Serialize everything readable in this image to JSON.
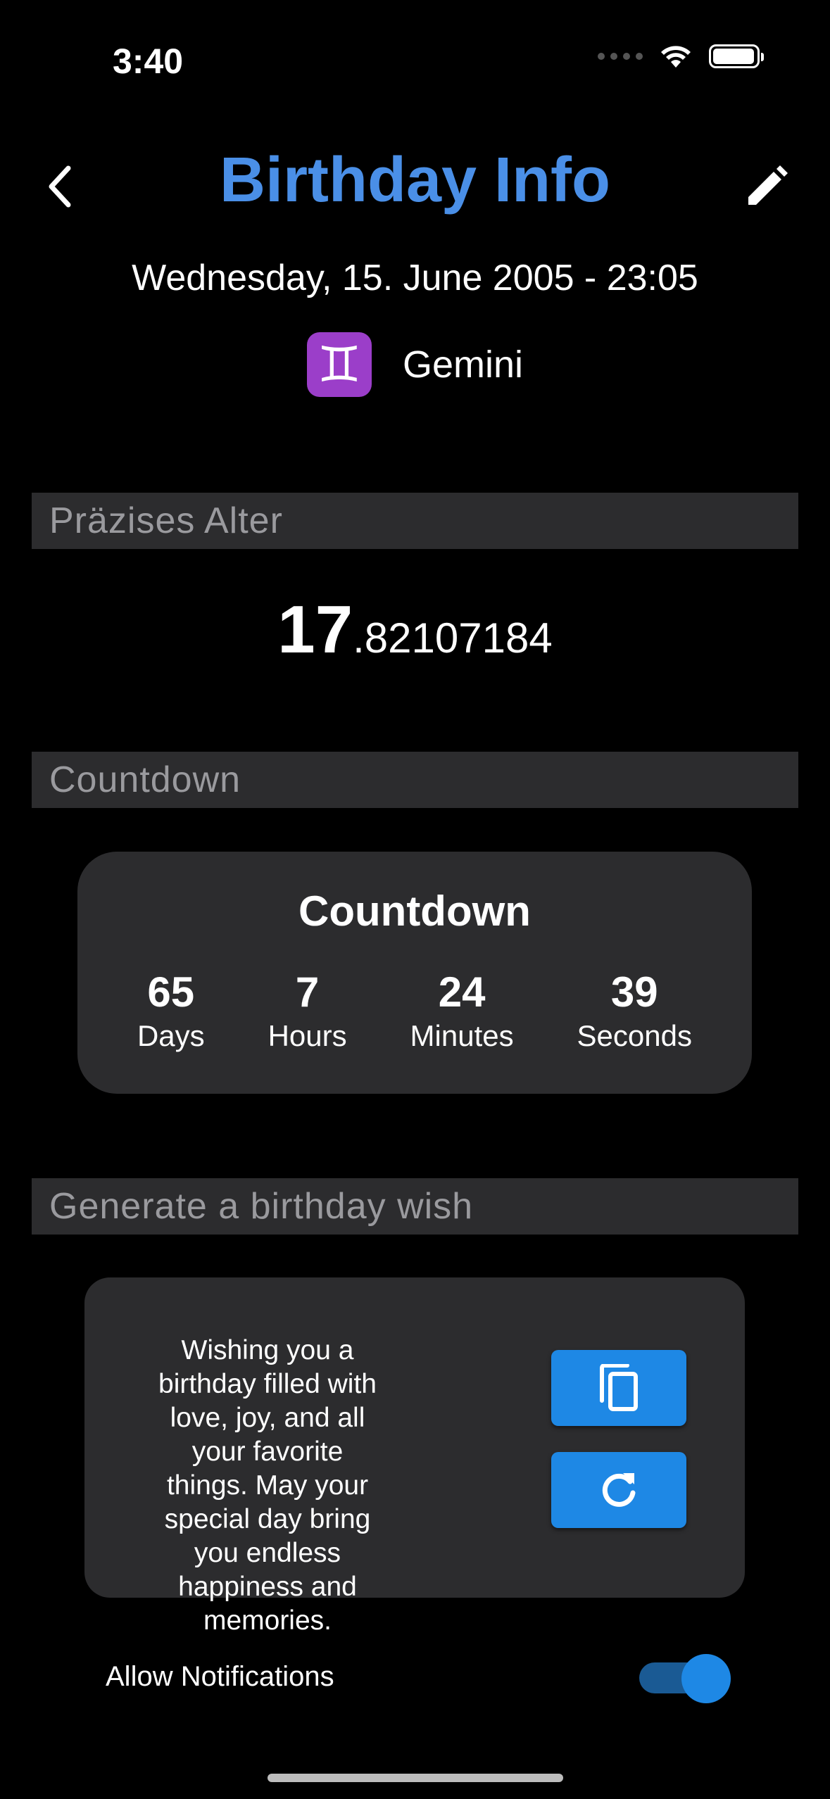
{
  "status_bar": {
    "time": "3:40"
  },
  "header": {
    "title": "Birthday Info"
  },
  "birth": {
    "date_time": "Wednesday, 15. June 2005 - 23:05",
    "zodiac_symbol": "♊",
    "zodiac_name": "Gemini"
  },
  "sections": {
    "age_header": "Präzises Alter",
    "countdown_header": "Countdown",
    "wish_header": "Generate a birthday wish"
  },
  "age": {
    "integer": "17",
    "fraction": ".82107184"
  },
  "countdown": {
    "title": "Countdown",
    "units": [
      {
        "value": "65",
        "label": "Days"
      },
      {
        "value": "7",
        "label": "Hours"
      },
      {
        "value": "24",
        "label": "Minutes"
      },
      {
        "value": "39",
        "label": "Seconds"
      }
    ]
  },
  "wish": {
    "text": "Wishing you a birthday filled with love, joy, and all your favorite things. May your special day bring you endless happiness and memories."
  },
  "notifications": {
    "label": "Allow Notifications",
    "enabled": true
  },
  "colors": {
    "accent": "#4a8fe7",
    "button": "#1e88e5",
    "card": "#2c2c2e",
    "zodiac": "#9b3ec9"
  },
  "icons": {
    "back": "chevron-left-icon",
    "edit": "pencil-icon",
    "copy": "copy-icon",
    "refresh": "refresh-icon"
  }
}
